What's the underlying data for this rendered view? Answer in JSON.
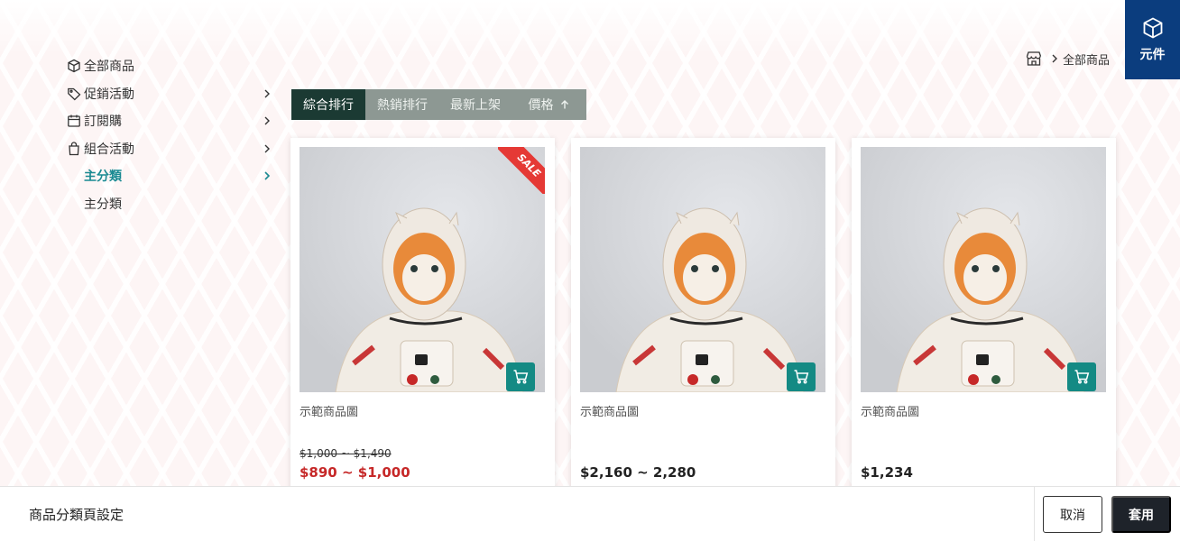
{
  "sidebar": {
    "items": [
      {
        "label": "全部商品",
        "icon": "box-icon"
      },
      {
        "label": "促銷活動",
        "icon": "tag-icon"
      },
      {
        "label": "訂閱購",
        "icon": "calendar-icon"
      },
      {
        "label": "組合活動",
        "icon": "bag-icon"
      },
      {
        "label": "主分類",
        "active": true
      },
      {
        "label": "主分類"
      }
    ]
  },
  "breadcrumb": {
    "current": "全部商品"
  },
  "component_button": {
    "label": "元件"
  },
  "sort": {
    "tabs": [
      {
        "label": "綜合排行",
        "selected": true
      },
      {
        "label": "熱銷排行"
      },
      {
        "label": "最新上架"
      },
      {
        "label": "價格"
      }
    ]
  },
  "products": [
    {
      "name": "示範商品圖",
      "original_price": "$1,000 ~ $1,490",
      "price": "$890 ~ $1,000",
      "badge": "SALE"
    },
    {
      "name": "示範商品圖",
      "price": "$2,160 ~ 2,280"
    },
    {
      "name": "示範商品圖",
      "price": "$1,234"
    }
  ],
  "footer": {
    "title": "商品分類頁設定",
    "cancel_label": "取消",
    "apply_label": "套用"
  },
  "colors": {
    "accent": "#1a8a92",
    "sale": "#c62828",
    "component_bg": "#0b3d7e",
    "sort_selected": "#1b3a33",
    "cart": "#148a84"
  }
}
